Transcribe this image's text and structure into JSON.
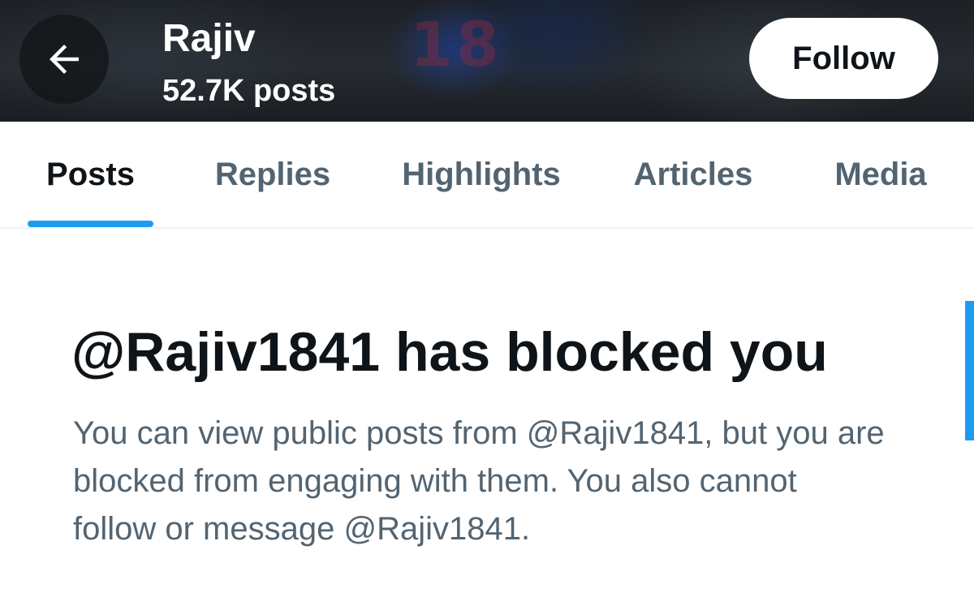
{
  "header": {
    "banner_number": "18",
    "profile_name": "Rajiv",
    "post_count": "52.7K posts",
    "follow_label": "Follow"
  },
  "tabs": [
    {
      "label": "Posts",
      "active": true
    },
    {
      "label": "Replies",
      "active": false
    },
    {
      "label": "Highlights",
      "active": false
    },
    {
      "label": "Articles",
      "active": false
    },
    {
      "label": "Media",
      "active": false
    }
  ],
  "blocked": {
    "title": "@Rajiv1841 has blocked you",
    "description": "You can view public posts from @Rajiv1841, but you are blocked from engaging with them. You also cannot follow or message @Rajiv1841."
  },
  "colors": {
    "accent": "#1d9bf0",
    "primary_text": "#0f1419",
    "secondary_text": "#536471"
  },
  "icons": {
    "back": "arrow-left-icon"
  }
}
